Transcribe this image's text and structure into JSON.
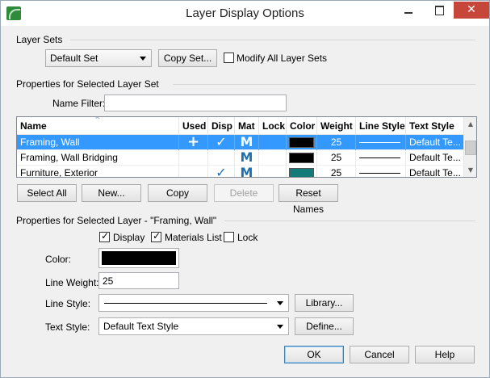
{
  "window": {
    "title": "Layer Display Options",
    "close_glyph": "✕"
  },
  "layer_sets": {
    "group_label": "Layer Sets",
    "selected_set": "Default Set",
    "copy_set_label": "Copy Set...",
    "modify_all_label": "Modify All Layer Sets",
    "modify_all_checked": false
  },
  "props_set": {
    "group_label": "Properties for Selected Layer Set",
    "name_filter_label": "Name Filter:",
    "name_filter_value": ""
  },
  "table": {
    "columns": [
      "Name",
      "Used",
      "Disp",
      "Mat",
      "Lock",
      "Color",
      "Weight",
      "Line Style",
      "Text Style"
    ],
    "sort_glyph": "^",
    "rows": [
      {
        "name": "Framing, Wall",
        "used": "+",
        "disp": "✓",
        "mat": "M",
        "lock": "",
        "color": "#000000",
        "weight": "25",
        "text_style": "Default Te...",
        "selected": true
      },
      {
        "name": "Framing, Wall Bridging",
        "used": "",
        "disp": "",
        "mat": "M",
        "lock": "",
        "color": "#000000",
        "weight": "25",
        "text_style": "Default Te...",
        "selected": false
      },
      {
        "name": "Furniture, Exterior",
        "used": "",
        "disp": "✓",
        "mat": "M",
        "lock": "",
        "color": "#137a7a",
        "weight": "25",
        "text_style": "Default Te...",
        "selected": false
      }
    ]
  },
  "table_buttons": {
    "select_all": "Select All",
    "new": "New...",
    "copy": "Copy",
    "delete": "Delete",
    "reset_names": "Reset Names"
  },
  "props_layer": {
    "group_label": "Properties for Selected Layer - \"Framing, Wall\"",
    "display_label": "Display",
    "display_checked": true,
    "materials_label": "Materials List",
    "materials_checked": true,
    "lock_label": "Lock",
    "lock_checked": false,
    "color_label": "Color:",
    "color_value": "#000000",
    "line_weight_label": "Line Weight:",
    "line_weight_value": "25",
    "line_style_label": "Line Style:",
    "library_label": "Library...",
    "text_style_label": "Text Style:",
    "text_style_value": "Default Text Style",
    "define_label": "Define..."
  },
  "footer": {
    "ok": "OK",
    "cancel": "Cancel",
    "help": "Help"
  },
  "check_glyph": "✓"
}
